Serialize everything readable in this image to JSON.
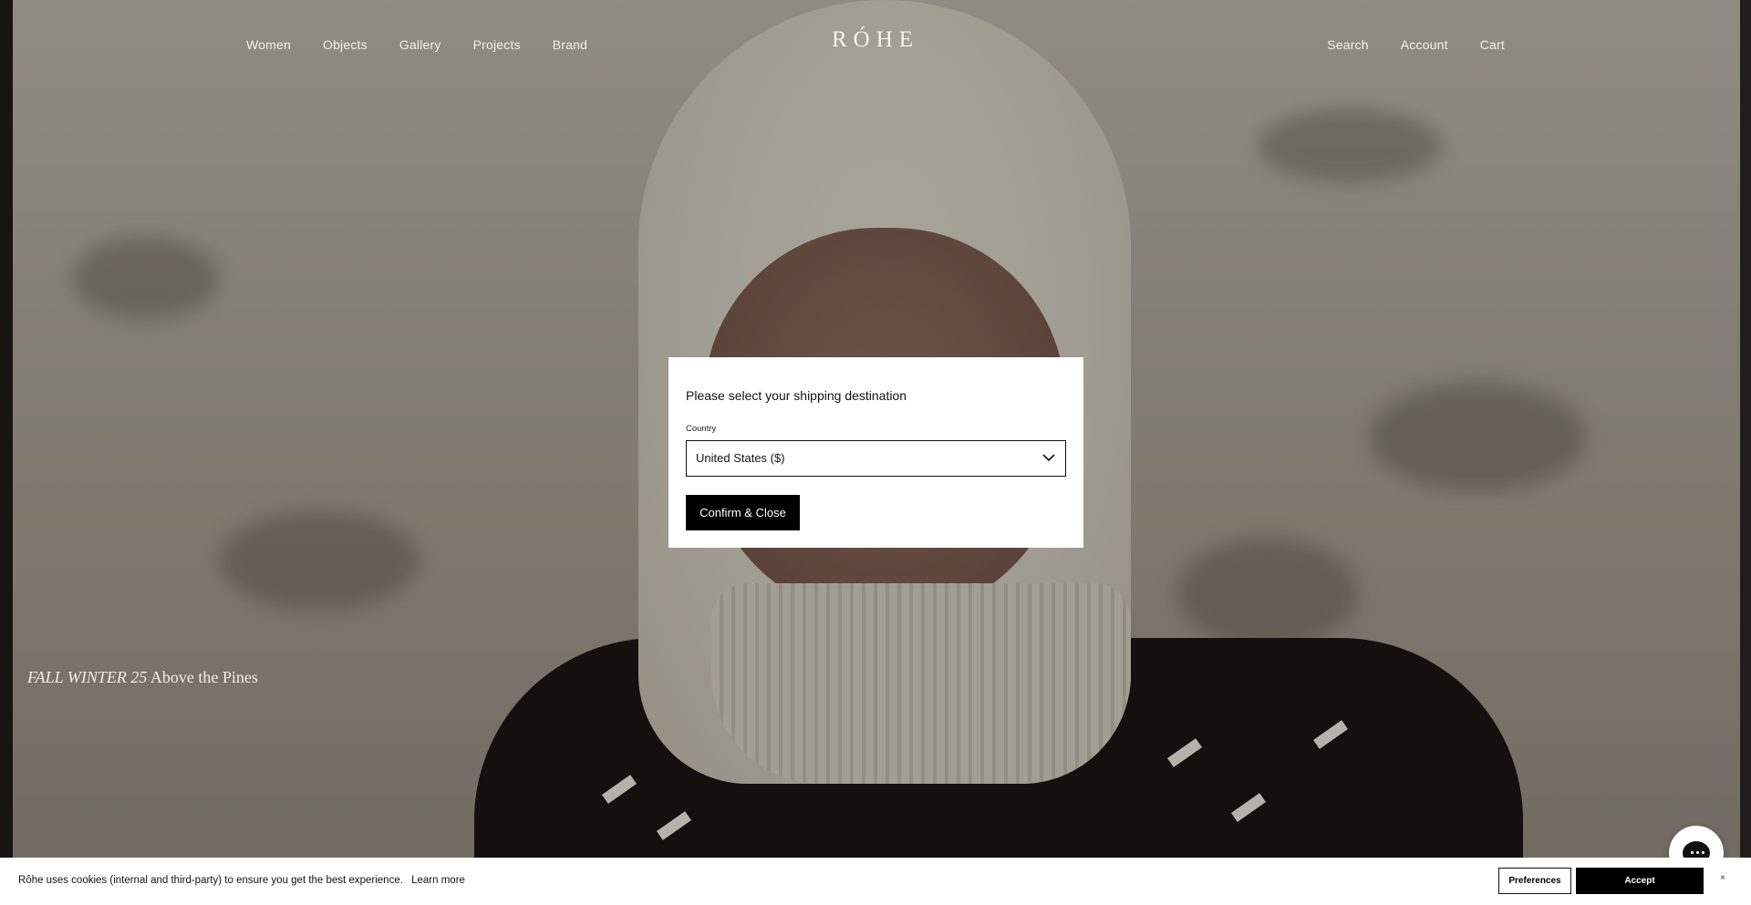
{
  "header": {
    "logo": "RÓHE",
    "nav_left": [
      "Women",
      "Objects",
      "Gallery",
      "Projects",
      "Brand"
    ],
    "nav_right": [
      "Search",
      "Account",
      "Cart"
    ]
  },
  "hero": {
    "caption_season": "FALL WINTER 25",
    "caption_title": "Above the Pines"
  },
  "shipping_modal": {
    "title": "Please select your shipping destination",
    "country_label": "Country",
    "country_value": "United States ($)",
    "confirm_label": "Confirm & Close"
  },
  "cookie_banner": {
    "message": "Rôhe uses cookies (internal and third-party) to ensure you get the best experience.",
    "learn_more": "Learn more",
    "preferences_label": "Preferences",
    "accept_label": "Accept",
    "close_label": "×"
  },
  "icons": {
    "country_select": "chevron-down-icon",
    "chat": "chat-bubble-icon"
  }
}
